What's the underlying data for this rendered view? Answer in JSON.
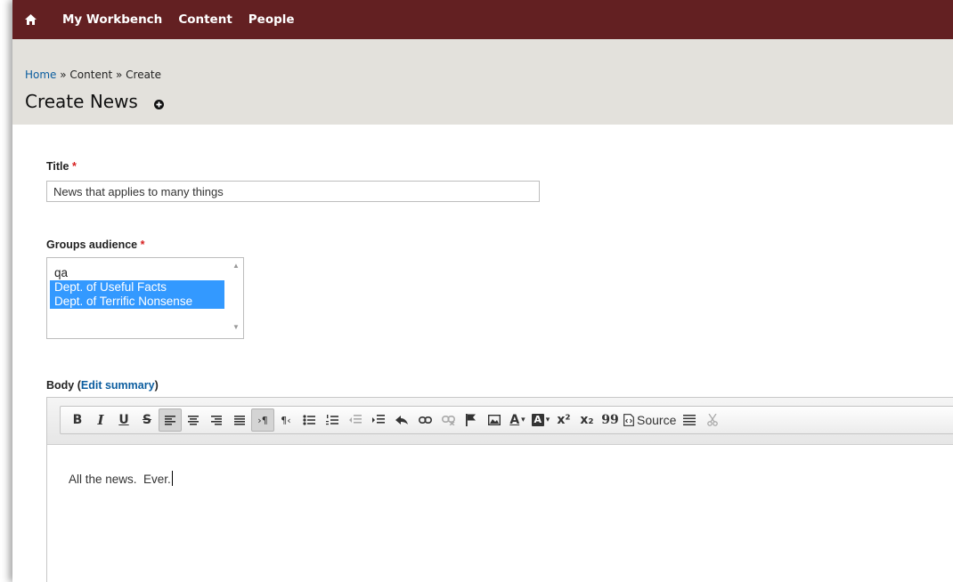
{
  "toolbar": {
    "items": [
      "My Workbench",
      "Content",
      "People"
    ]
  },
  "breadcrumb": {
    "home": "Home",
    "sep": " » ",
    "content": "Content",
    "create": "Create"
  },
  "page": {
    "title": "Create News"
  },
  "form": {
    "title_label": "Title",
    "required_mark": "*",
    "title_value": "News that applies to many things",
    "groups_label": "Groups audience",
    "groups_options": [
      "qa",
      "Dept. of Useful Facts",
      "Dept. of Terrific Nonsense"
    ],
    "groups_selected": [
      1,
      2
    ],
    "body_label": "Body (",
    "body_link": "Edit summary",
    "body_close": ")",
    "body_text": "All the news.  Ever."
  },
  "editor": {
    "source_label": "Source",
    "buttons": [
      "B",
      "I",
      "U",
      "S",
      "¶",
      "A",
      "x²",
      "x₂",
      "99"
    ]
  },
  "colors": {
    "toolbar_bg": "#632022",
    "header_bg": "#e3e1dc",
    "link": "#0b5d9f",
    "required": "#d61e1e",
    "selection": "#3399ff"
  }
}
